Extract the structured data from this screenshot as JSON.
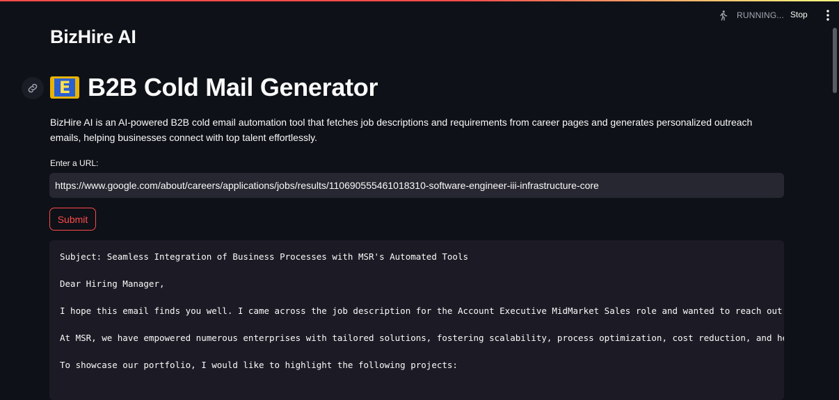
{
  "status": {
    "running_text": "RUNNING...",
    "stop_label": "Stop",
    "running_icon": "running-person-icon",
    "menu_icon": "vertical-dots-icon"
  },
  "app": {
    "title": "BizHire AI"
  },
  "page": {
    "heading_emoji": "E",
    "heading": "B2B Cold Mail Generator",
    "anchor_icon": "link-icon",
    "description": "BizHire AI is an AI-powered B2B cold email automation tool that fetches job descriptions and requirements from career pages and generates personalized outreach emails, helping businesses connect with top talent effortlessly."
  },
  "form": {
    "url_label": "Enter a URL:",
    "url_value": "https://www.google.com/about/careers/applications/jobs/results/110690555461018310-software-engineer-iii-infrastructure-core",
    "submit_label": "Submit"
  },
  "email_output": {
    "lines": [
      "Subject: Seamless Integration of Business Processes with MSR's Automated Tools",
      "Dear Hiring Manager,",
      "I hope this email finds you well. I came across the job description for the Account Executive MidMarket Sales role and wanted to reach out to",
      "At MSR, we have empowered numerous enterprises with tailored solutions, fostering scalability, process optimization, cost reduction, and heig",
      "To showcase our portfolio, I would like to highlight the following projects:"
    ]
  },
  "colors": {
    "background": "#0e1117",
    "accent": "#ff4b4b",
    "input_bg": "#262730",
    "code_bg": "#1c1b25"
  }
}
